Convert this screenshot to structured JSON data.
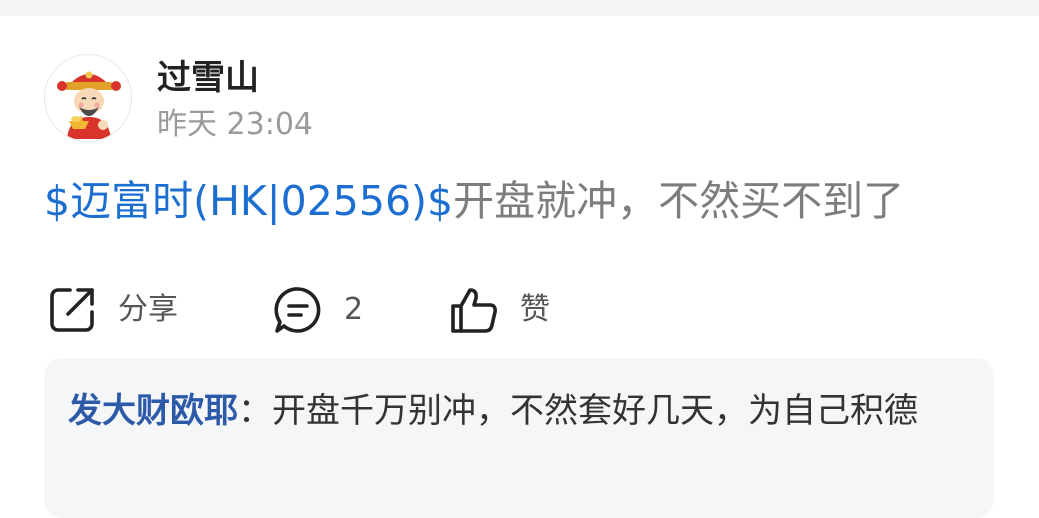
{
  "post": {
    "username": "过雪山",
    "timestamp": "昨天 23:04",
    "stock_tag": "$迈富时(HK|02556)$",
    "text": "开盘就冲，不然买不到了"
  },
  "actions": {
    "share_label": "分享",
    "comment_count": "2",
    "like_label": "赞"
  },
  "comment": {
    "author": "发大财欧耶",
    "separator": "：",
    "text": "开盘千万别冲，不然套好几天，为自己积德"
  },
  "colors": {
    "link": "#1c6fd1",
    "comment_author": "#2c5aa8",
    "comment_bg": "#f5f6f8"
  },
  "icons": {
    "avatar": "god-of-wealth-avatar",
    "share": "share-icon",
    "comment": "comment-icon",
    "like": "thumbs-up-icon"
  }
}
